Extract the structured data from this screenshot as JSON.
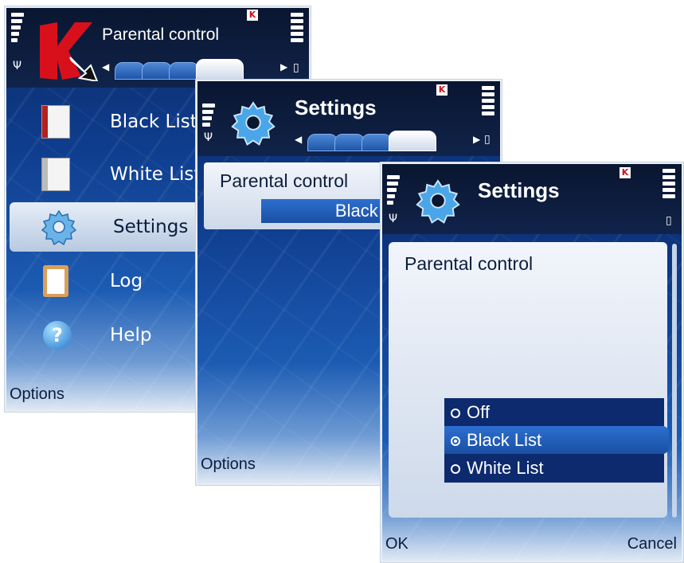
{
  "screen1": {
    "title": "Parental control",
    "menu": [
      {
        "label": "Black List",
        "icon": "black-list-icon"
      },
      {
        "label": "White List",
        "icon": "white-list-icon"
      },
      {
        "label": "Settings",
        "icon": "gear-icon"
      },
      {
        "label": "Log",
        "icon": "clipboard-icon"
      },
      {
        "label": "Help",
        "icon": "help-icon"
      }
    ],
    "left_softkey": "Options",
    "selected_index": 2
  },
  "screen2": {
    "title": "Settings",
    "field_label": "Parental control",
    "field_value": "Black List",
    "left_softkey": "Options"
  },
  "screen3": {
    "title": "Settings",
    "field_label": "Parental control",
    "options": [
      "Off",
      "Black List",
      "White List"
    ],
    "selected_option": "Black List",
    "left_softkey": "OK",
    "right_softkey": "Cancel"
  },
  "brand_badge": "K",
  "colors": {
    "accent": "#1a4fa3",
    "brand_red": "#d0101a",
    "bg_dark": "#0b2a66"
  }
}
